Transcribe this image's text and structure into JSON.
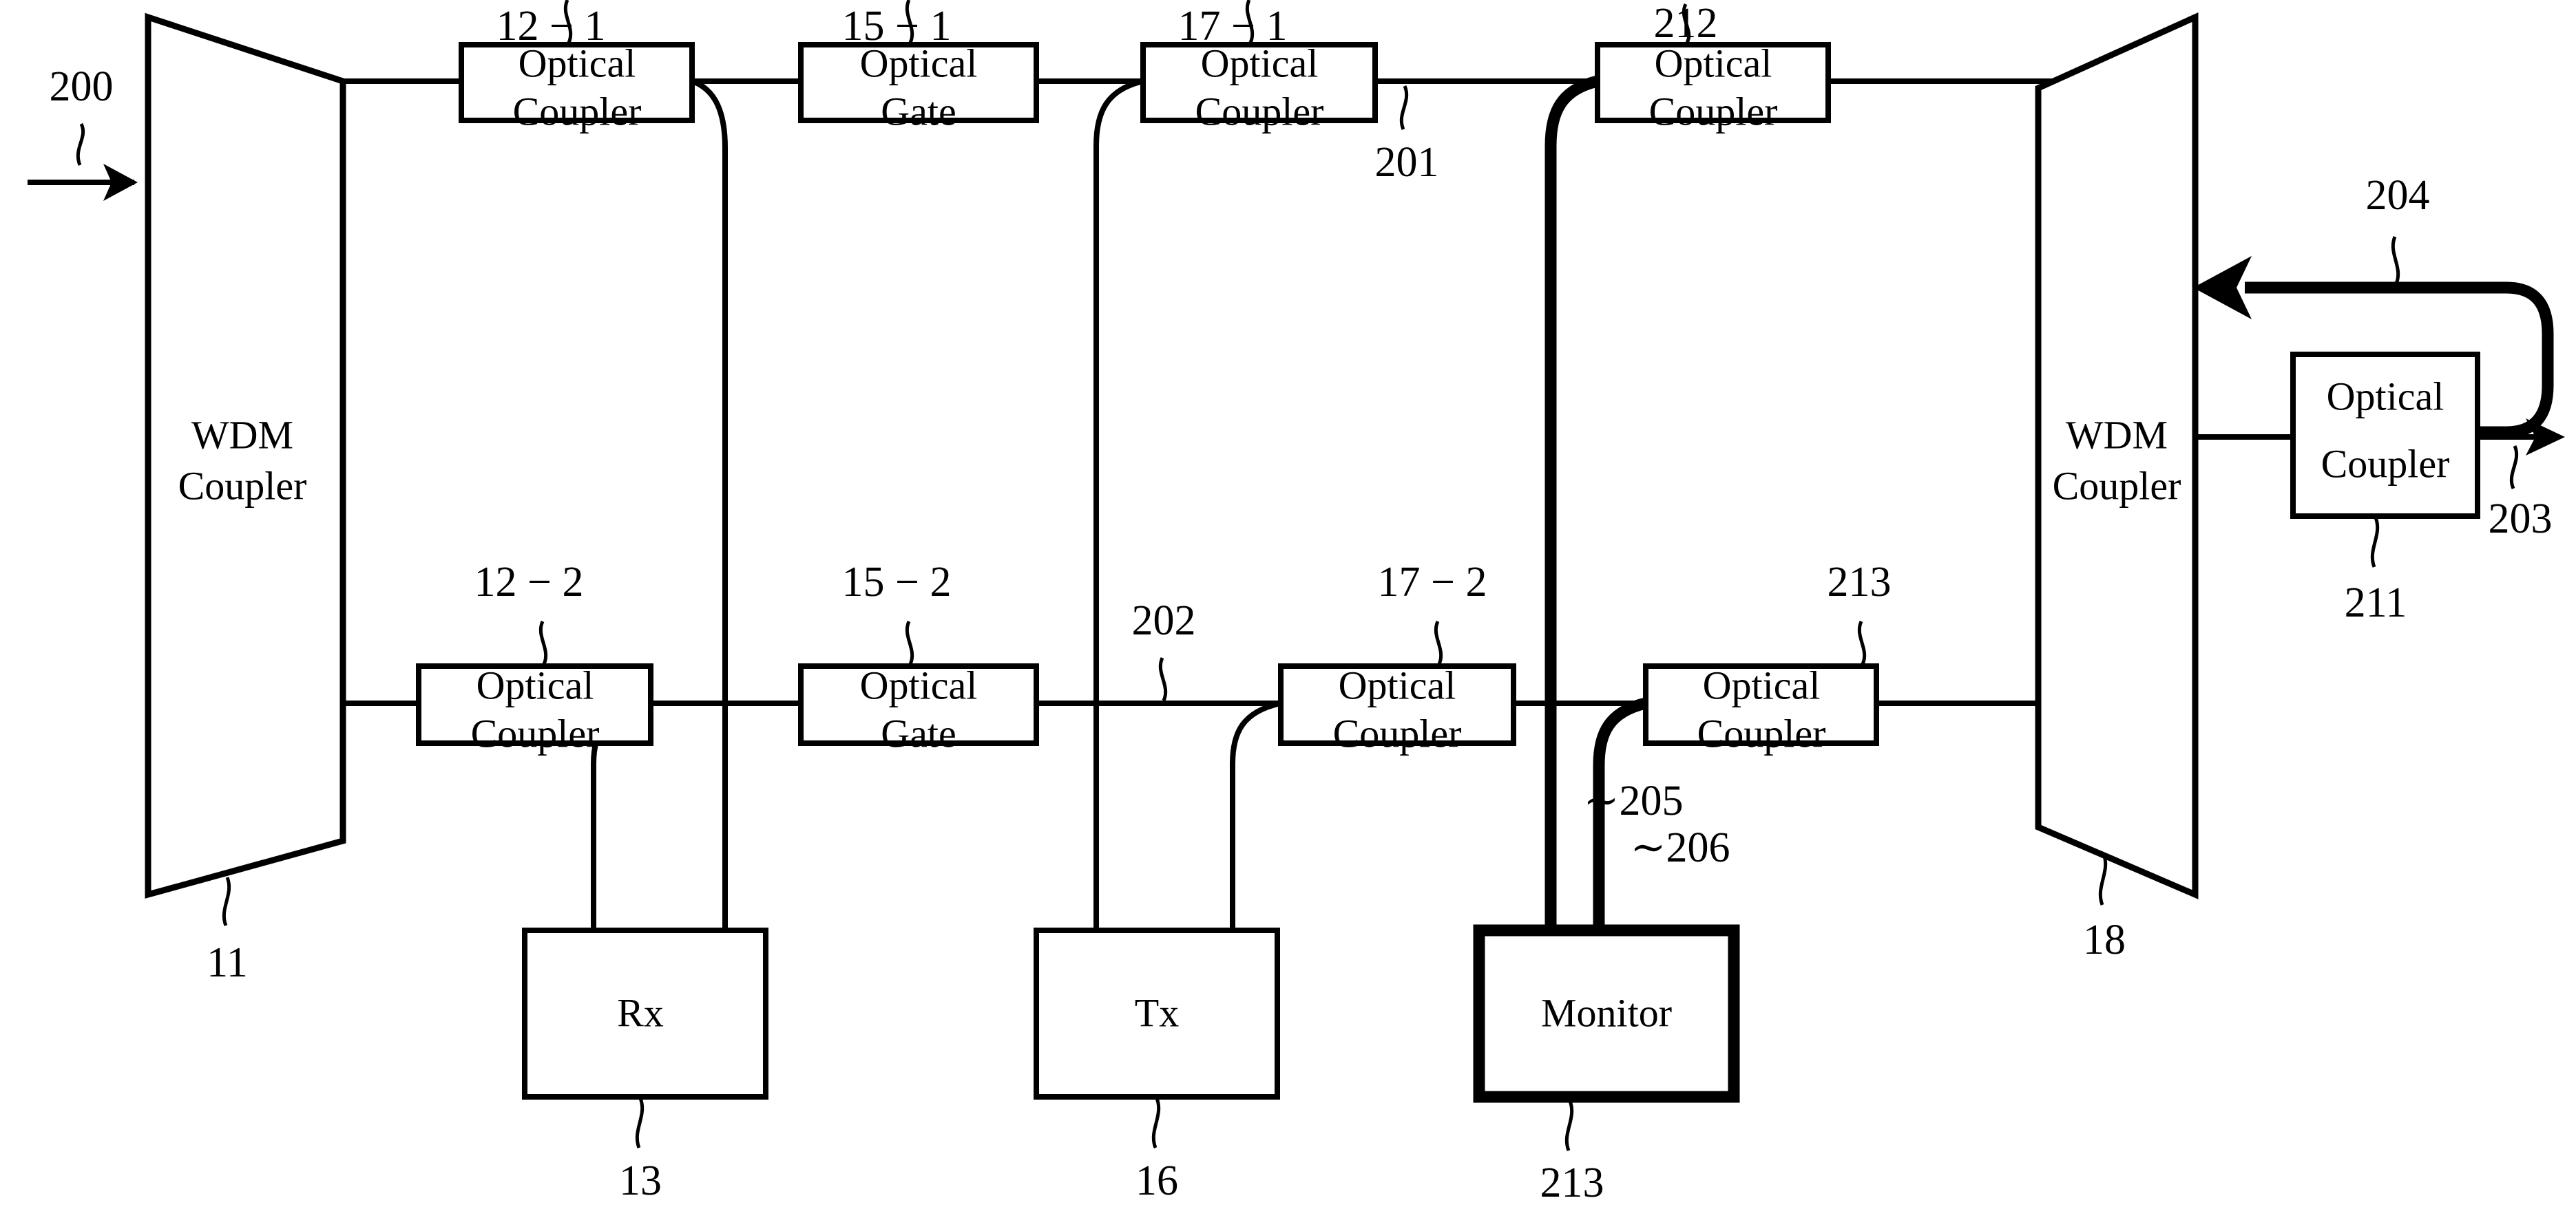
{
  "figure": {
    "type": "patent-block-diagram",
    "background": "#ffffff",
    "line_color": "#000000"
  },
  "blocks": {
    "wdm_left": {
      "line1": "WDM",
      "line2": "Coupler",
      "ref": "11"
    },
    "wdm_right": {
      "line1": "WDM",
      "line2": "Coupler",
      "ref": "18"
    },
    "coupler_12_1": {
      "line1": "Optical",
      "line2": "Coupler",
      "ref": "12 − 1"
    },
    "coupler_12_2": {
      "line1": "Optical",
      "line2": "Coupler",
      "ref": "12 − 2"
    },
    "gate_15_1": {
      "line1": "Optical",
      "line2": "Gate",
      "ref": "15 − 1"
    },
    "gate_15_2": {
      "line1": "Optical",
      "line2": "Gate",
      "ref": "15 − 2"
    },
    "coupler_17_1": {
      "line1": "Optical",
      "line2": "Coupler",
      "ref": "17 − 1"
    },
    "coupler_17_2": {
      "line1": "Optical",
      "line2": "Coupler",
      "ref": "17 − 2"
    },
    "coupler_212": {
      "line1": "Optical",
      "line2": "Coupler",
      "ref": "212"
    },
    "coupler_213": {
      "line1": "Optical",
      "line2": "Coupler",
      "ref": "213"
    },
    "coupler_211": {
      "line1": "Optical",
      "line2": "Coupler",
      "ref": "211"
    },
    "rx": {
      "line1": "Rx",
      "ref": "13"
    },
    "tx": {
      "line1": "Tx",
      "ref": "16"
    },
    "monitor": {
      "line1": "Monitor",
      "ref": "213"
    }
  },
  "signal_refs": {
    "input_200": "200",
    "path_201": "201",
    "path_202": "202",
    "output_203": "203",
    "feedback_204": "204",
    "monitor_tap_205": "∼205",
    "monitor_tap_206": "∼206"
  }
}
